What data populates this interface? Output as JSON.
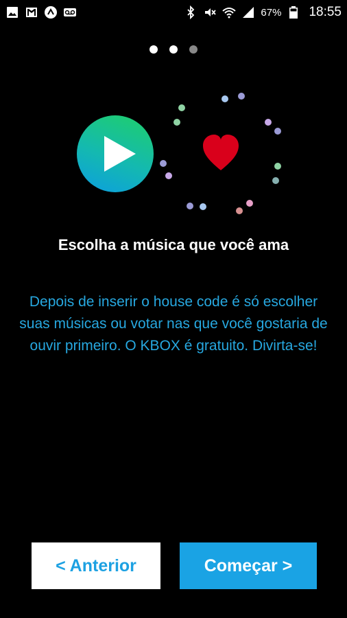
{
  "status_bar": {
    "icons_left": [
      "image-icon",
      "gmail-icon",
      "app-icon",
      "voicemail-icon"
    ],
    "icons_right": [
      "bluetooth-icon",
      "mute-icon",
      "wifi-icon",
      "signal-icon"
    ],
    "battery": "67%",
    "time": "18:55"
  },
  "pager": {
    "total": 3,
    "active": 2
  },
  "illustration": {
    "play_gradient": [
      "#1fcf6a",
      "#0c9ee0"
    ],
    "heart_color": "#d9001b"
  },
  "content": {
    "title": "Escolha a música que você ama",
    "description": "Depois de inserir o house code é só escolher suas músicas ou votar nas que você gostaria de ouvir primeiro. O KBOX é gratuito. Divirta-se!"
  },
  "buttons": {
    "previous": "< Anterior",
    "start": "Começar >"
  },
  "colors": {
    "accent": "#1aa3e4",
    "text_accent": "#27a8e0",
    "background": "#000000"
  }
}
